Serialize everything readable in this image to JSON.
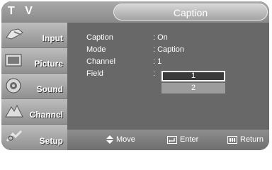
{
  "header": {
    "app": "T V",
    "title": "Caption"
  },
  "sidebar": {
    "items": [
      {
        "label": "Input",
        "icon": "input-icon"
      },
      {
        "label": "Picture",
        "icon": "picture-icon"
      },
      {
        "label": "Sound",
        "icon": "sound-icon"
      },
      {
        "label": "Channel",
        "icon": "channel-icon"
      },
      {
        "label": "Setup",
        "icon": "setup-icon"
      }
    ]
  },
  "menu": {
    "rows": [
      {
        "label": "Caption",
        "value": ": On"
      },
      {
        "label": "Mode",
        "value": ": Caption"
      },
      {
        "label": "Channel",
        "value": ": 1"
      },
      {
        "label": "Field",
        "value": ":"
      }
    ],
    "field_options": [
      "1",
      "2"
    ],
    "selected_option": "1"
  },
  "footer": {
    "move": "Move",
    "enter": "Enter",
    "return": "Return"
  },
  "colors": {
    "background": "#686868",
    "text": "#ffffff",
    "highlight": "#3a3a3a"
  }
}
